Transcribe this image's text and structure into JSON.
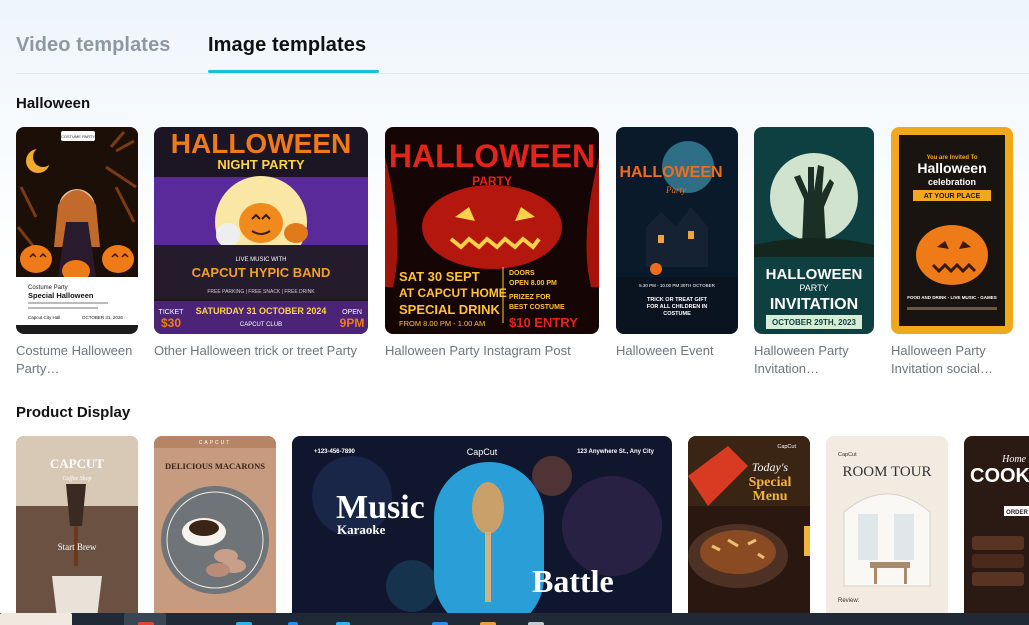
{
  "tabs": [
    {
      "label": "Video templates",
      "active": false
    },
    {
      "label": "Image templates",
      "active": true
    }
  ],
  "sections": {
    "halloween": {
      "title": "Halloween",
      "items": [
        {
          "caption": "Costume Halloween Party…",
          "art": {
            "t1": "COSTUME PARTY",
            "t2": "Costume Party",
            "t3": "Special Halloween",
            "t4": "Capcut City Hall",
            "t5": "OCTOBER 31, 2026"
          }
        },
        {
          "caption": "Other Halloween trick or treet Party",
          "art": {
            "t1": "HALLOWEEN",
            "t2": "NIGHT PARTY",
            "t3": "LIVE MUSIC WITH",
            "t4": "CAPCUT HYPIC BAND",
            "t5": "FREE PARKING  |  FREE SNACK  |  FREE DRINK",
            "t6": "TICKET",
            "t7": "$30",
            "t8": "SATURDAY 31 OCTOBER  2024",
            "t9": "CAPCUT CLUB",
            "t10": "OPEN",
            "t11": "9PM"
          }
        },
        {
          "caption": "Halloween Party Instagram Post",
          "art": {
            "t1": "HALLOWEEN",
            "t2": "PARTY",
            "t3": "SAT 30 SEPT",
            "t4": "AT CAPCUT HOME",
            "t5": "SPECIAL DRINK",
            "t6": "FROM 8.00 PM - 1.00 AM",
            "t7": "DOORS",
            "t8": "OPEN 8.00 PM",
            "t9": "PRIZEZ FOR",
            "t10": "BEST COSTUME",
            "t11": "$10 ENTRY"
          }
        },
        {
          "caption": "Halloween Event",
          "art": {
            "t1": "HALLOWEEN",
            "t2": "Party",
            "t3": "5.30 PM - 10.00 PM 30TH OCTOBER",
            "t4": "TRICK OR TREAT GIFT",
            "t5": "FOR ALL CHILDREN IN",
            "t6": "COSTUME"
          }
        },
        {
          "caption": "Halloween Party Invitation…",
          "art": {
            "t1": "HALLOWEEN",
            "t2": "PARTY",
            "t3": "INVITATION",
            "t4": "OCTOBER 29TH, 2023"
          }
        },
        {
          "caption": "Halloween Party Invitation social…",
          "art": {
            "t1": "You are Invited To",
            "t2": "Halloween",
            "t3": "celebration",
            "t4": "AT YOUR PLACE",
            "t5": "FOOD AND DRINK - LIVE MUSIC - GAMES"
          }
        }
      ]
    },
    "product": {
      "title": "Product Display",
      "items": [
        {
          "art": {
            "t1": "CAPCUT",
            "t2": "Coffee Shop",
            "t3": "Start Brew"
          }
        },
        {
          "art": {
            "t1": "CAPCUT",
            "t2": "DELICIOUS MACARONS"
          }
        },
        {
          "art": {
            "t1": "+123-456-7890",
            "t2": "CapCut",
            "t3": "123 Anywhere St., Any City",
            "t4": "Music",
            "t5": "Karaoke",
            "t6": "Battle"
          }
        },
        {
          "art": {
            "t1": "CapCut",
            "t2": "Today's",
            "t3": "Special",
            "t4": "Menu"
          }
        },
        {
          "art": {
            "t1": "CapCut",
            "t2": "ROOM TOUR",
            "t3": "Review:"
          }
        },
        {
          "art": {
            "t1": "Home",
            "t2": "COOK",
            "t3": "ORDER"
          }
        }
      ]
    }
  },
  "colors": {
    "accent": "#18c2d6",
    "caption": "#6e757c",
    "taskbar": "#1f2a36"
  }
}
